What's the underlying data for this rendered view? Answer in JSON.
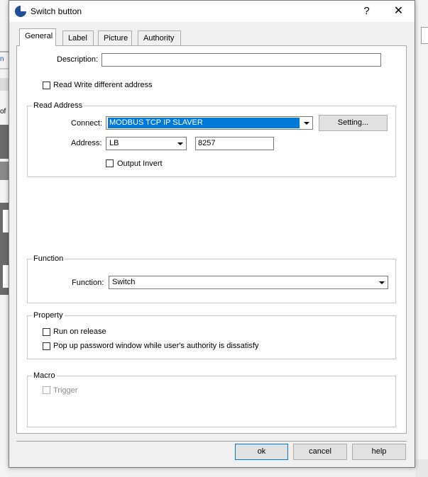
{
  "window": {
    "title": "Switch button",
    "help_glyph": "?",
    "close_glyph": "✕"
  },
  "background": {
    "left_text": "n",
    "left_text2": "of"
  },
  "tabs": [
    {
      "label": "General",
      "active": true
    },
    {
      "label": "Label",
      "active": false
    },
    {
      "label": "Picture",
      "active": false
    },
    {
      "label": "Authority",
      "active": false
    }
  ],
  "general": {
    "description_label": "Description:",
    "description_value": "",
    "read_write_different_label": "Read Write different address",
    "read_address": {
      "legend": "Read Address",
      "connect_label": "Connect:",
      "connect_value": "MODBUS TCP IP SLAVER",
      "setting_button": "Setting...",
      "address_label": "Address:",
      "address_type": "LB",
      "address_value": "8257",
      "output_invert_label": "Output Invert"
    },
    "function": {
      "legend": "Function",
      "function_label": "Function:",
      "function_value": "Switch"
    },
    "property": {
      "legend": "Property",
      "run_on_release_label": "Run on release",
      "popup_password_label": "Pop up password window while user's authority is dissatisfy"
    },
    "macro": {
      "legend": "Macro",
      "trigger_label": "Trigger"
    }
  },
  "footer": {
    "ok": "ok",
    "cancel": "cancel",
    "help": "help"
  },
  "colors": {
    "selection": "#0078d7",
    "panel": "#ffffff",
    "dialog": "#f0f0f0"
  }
}
